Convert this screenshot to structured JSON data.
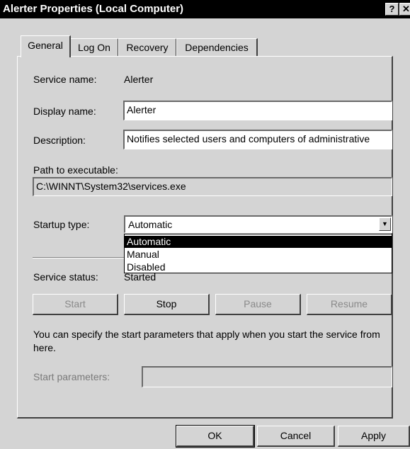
{
  "window": {
    "title": "Alerter Properties (Local Computer)",
    "help_button": "?",
    "close_button": "✕"
  },
  "tabs": [
    {
      "label": "General",
      "active": true
    },
    {
      "label": "Log On",
      "active": false
    },
    {
      "label": "Recovery",
      "active": false
    },
    {
      "label": "Dependencies",
      "active": false
    }
  ],
  "general": {
    "service_name_label": "Service name:",
    "service_name_value": "Alerter",
    "display_name_label": "Display name:",
    "display_name_value": "Alerter",
    "description_label": "Description:",
    "description_value": "Notifies selected users and computers of administrative",
    "path_label": "Path to executable:",
    "path_value": "C:\\WINNT\\System32\\services.exe",
    "startup_type_label": "Startup type:",
    "startup_type_value": "Automatic",
    "startup_options": [
      "Automatic",
      "Manual",
      "Disabled"
    ],
    "startup_selected": "Automatic",
    "service_status_label": "Service status:",
    "service_status_value": "Started",
    "buttons": {
      "start": "Start",
      "stop": "Stop",
      "pause": "Pause",
      "resume": "Resume"
    },
    "hint_text": "You can specify the start parameters that apply when you start the service from here.",
    "start_parameters_label": "Start parameters:",
    "start_parameters_value": ""
  },
  "footer": {
    "ok": "OK",
    "cancel": "Cancel",
    "apply": "Apply"
  }
}
